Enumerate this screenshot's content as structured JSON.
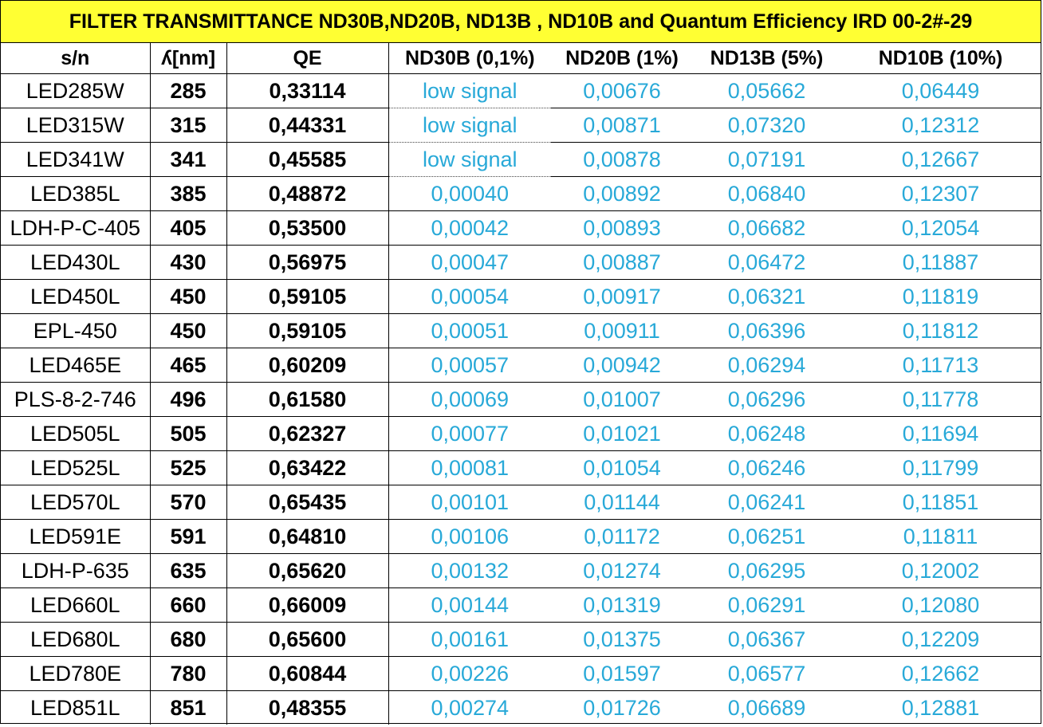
{
  "title": "FILTER TRANSMITTANCE ND30B,ND20B, ND13B , ND10B and Quantum Efficiency IRD 00-2#-29",
  "colors": {
    "title_bg": "#ffff33",
    "value_text": "#28a9d8",
    "label_text": "#000000"
  },
  "table": {
    "headers": [
      "s/n",
      "ʎ[nm]",
      "QE",
      "ND30B (0,1%)",
      "ND20B (1%)",
      "ND13B (5%)",
      "ND10B (10%)"
    ],
    "rows": [
      [
        "LED285W",
        "285",
        "0,33114",
        "low signal",
        "0,00676",
        "0,05662",
        "0,06449"
      ],
      [
        "LED315W",
        "315",
        "0,44331",
        "low signal",
        "0,00871",
        "0,07320",
        "0,12312"
      ],
      [
        "LED341W",
        "341",
        "0,45585",
        "low signal",
        "0,00878",
        "0,07191",
        "0,12667"
      ],
      [
        "LED385L",
        "385",
        "0,48872",
        "0,00040",
        "0,00892",
        "0,06840",
        "0,12307"
      ],
      [
        "LDH-P-C-405",
        "405",
        "0,53500",
        "0,00042",
        "0,00893",
        "0,06682",
        "0,12054"
      ],
      [
        "LED430L",
        "430",
        "0,56975",
        "0,00047",
        "0,00887",
        "0,06472",
        "0,11887"
      ],
      [
        "LED450L",
        "450",
        "0,59105",
        "0,00054",
        "0,00917",
        "0,06321",
        "0,11819"
      ],
      [
        "EPL-450",
        "450",
        "0,59105",
        "0,00051",
        "0,00911",
        "0,06396",
        "0,11812"
      ],
      [
        "LED465E",
        "465",
        "0,60209",
        "0,00057",
        "0,00942",
        "0,06294",
        "0,11713"
      ],
      [
        "PLS-8-2-746",
        "496",
        "0,61580",
        "0,00069",
        "0,01007",
        "0,06296",
        "0,11778"
      ],
      [
        "LED505L",
        "505",
        "0,62327",
        "0,00077",
        "0,01021",
        "0,06248",
        "0,11694"
      ],
      [
        "LED525L",
        "525",
        "0,63422",
        "0,00081",
        "0,01054",
        "0,06246",
        "0,11799"
      ],
      [
        "LED570L",
        "570",
        "0,65435",
        "0,00101",
        "0,01144",
        "0,06241",
        "0,11851"
      ],
      [
        "LED591E",
        "591",
        "0,64810",
        "0,00106",
        "0,01172",
        "0,06251",
        "0,11811"
      ],
      [
        "LDH-P-635",
        "635",
        "0,65620",
        "0,00132",
        "0,01274",
        "0,06295",
        "0,12002"
      ],
      [
        "LED660L",
        "660",
        "0,66009",
        "0,00144",
        "0,01319",
        "0,06291",
        "0,12080"
      ],
      [
        "LED680L",
        "680",
        "0,65600",
        "0,00161",
        "0,01375",
        "0,06367",
        "0,12209"
      ],
      [
        "LED780E",
        "780",
        "0,60844",
        "0,00226",
        "0,01597",
        "0,06577",
        "0,12662"
      ],
      [
        "LED851L",
        "851",
        "0,48355",
        "0,00274",
        "0,01726",
        "0,06689",
        "0,12881"
      ]
    ]
  }
}
